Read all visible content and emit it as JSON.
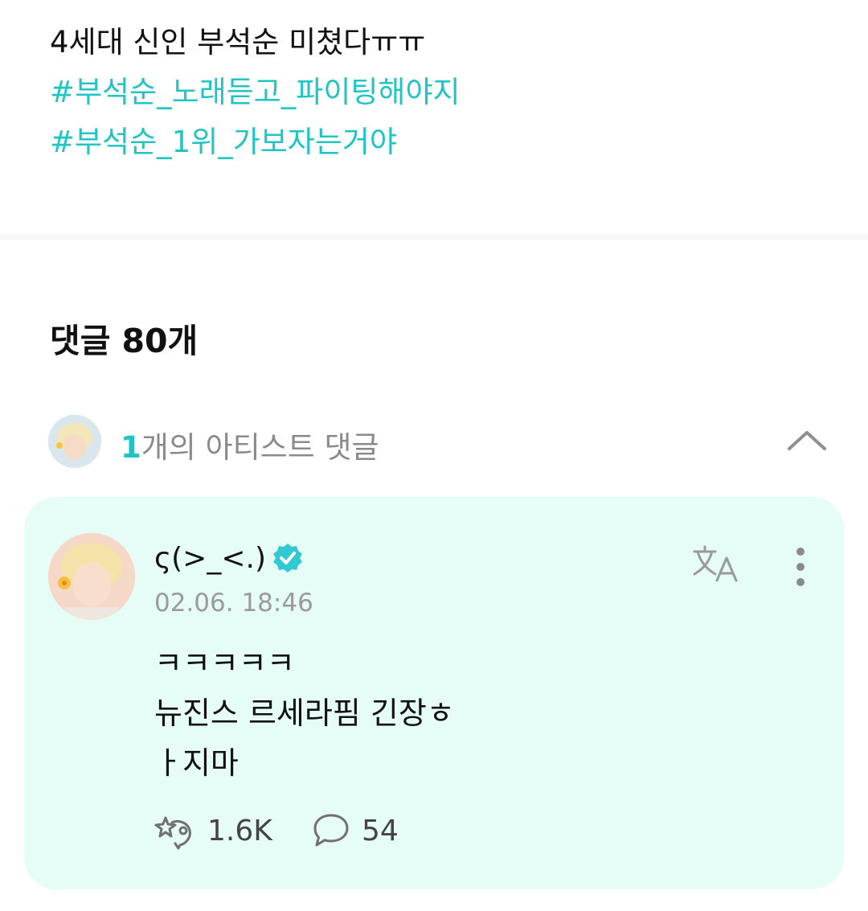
{
  "post": {
    "title": "4세대 신인 부석순 미쳤다ㅠㅠ",
    "hashtags": [
      "#부석순_노래듣고_파이팅해야지",
      "#부석순_1위_가보자는거야"
    ]
  },
  "comments": {
    "label": "댓글",
    "count": "80개"
  },
  "artist_comments": {
    "count": "1",
    "label": "개의 아티스트 댓글"
  },
  "comment": {
    "author": "ς(>_<.)",
    "date": "02.06. 18:46",
    "lines": [
      "ㅋㅋㅋㅋㅋ",
      "뉴진스 르세라핌 긴장ㅎ",
      "ㅏ지마"
    ],
    "likes": "1.6K",
    "replies": "54"
  },
  "colors": {
    "accent": "#20c4c4",
    "card_background": "#e6fcf7",
    "verified": "#34c8d2"
  },
  "icons": {
    "collapse": "chevron-up-icon",
    "verified": "verified-badge-icon",
    "translate": "translate-icon",
    "more": "more-vertical-icon",
    "like": "cheer-icon",
    "reply": "speech-bubble-icon"
  }
}
